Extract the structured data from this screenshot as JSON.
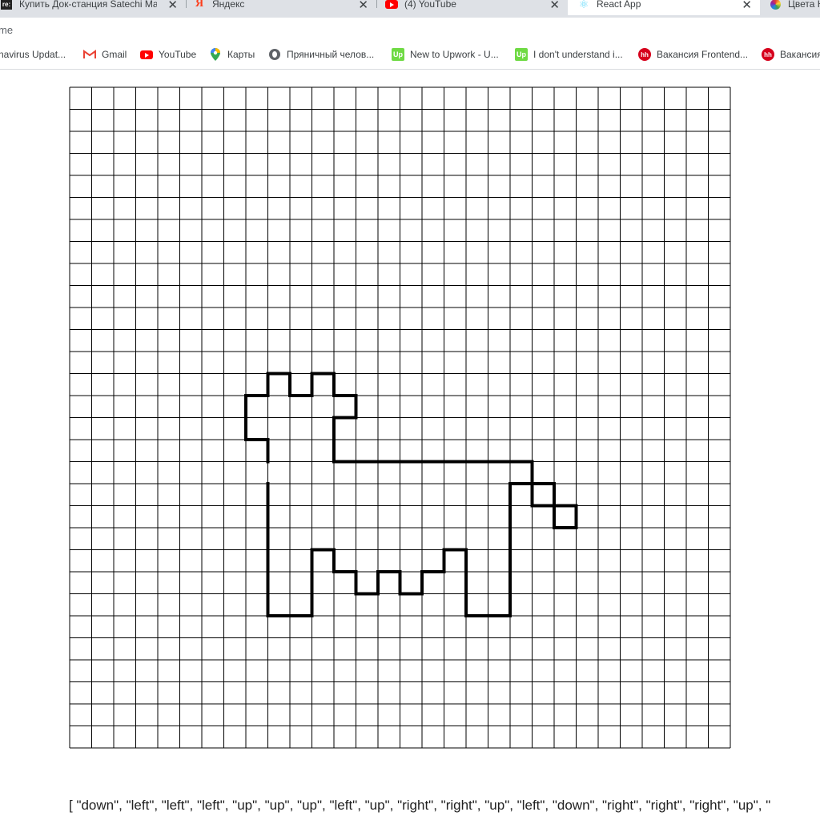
{
  "browser": {
    "tabs": [
      {
        "title": "Купить Док-станция Satechi Mac",
        "favicon": "shop-favicon",
        "active": false
      },
      {
        "title": "Яндекс",
        "favicon": "yandex-icon",
        "active": false
      },
      {
        "title": "(4) YouTube",
        "favicon": "youtube-icon",
        "active": false
      },
      {
        "title": "React App",
        "favicon": "react-icon",
        "active": true
      },
      {
        "title": "Цвета H",
        "favicon": "color-wheel-icon",
        "active": false
      }
    ],
    "close_glyph": "✕",
    "address": "me",
    "bookmarks": [
      {
        "label": "navirus Updat...",
        "icon": "none"
      },
      {
        "label": "Gmail",
        "icon": "gmail-icon"
      },
      {
        "label": "YouTube",
        "icon": "youtube-icon"
      },
      {
        "label": "Карты",
        "icon": "maps-icon"
      },
      {
        "label": "Пряничный челов...",
        "icon": "globe-icon"
      },
      {
        "label": "New to Upwork - U...",
        "icon": "upwork-icon"
      },
      {
        "label": "I don't understand i...",
        "icon": "upwork-icon"
      },
      {
        "label": "Вакансия Frontend...",
        "icon": "hh-icon"
      },
      {
        "label": "Вакансия",
        "icon": "hh-icon"
      }
    ]
  },
  "drawing": {
    "grid_size": 30,
    "grid_color": "#000000",
    "path_color": "#000000",
    "start_cell": [
      9,
      17
    ],
    "moves": [
      "up",
      "left",
      "up",
      "up",
      "right",
      "up",
      "right",
      "down",
      "right",
      "up",
      "right",
      "down",
      "right",
      "down",
      "left",
      "down",
      "down",
      "right",
      "right",
      "right",
      "right",
      "right",
      "right",
      "right",
      "right",
      "right",
      "down",
      "right",
      "down",
      "right",
      "down",
      "left",
      "up",
      "left",
      "up",
      "left",
      "down",
      "down",
      "down",
      "down",
      "down",
      "down",
      "left",
      "left",
      "up",
      "up",
      "up",
      "left",
      "down",
      "left",
      "down",
      "left",
      "up",
      "left",
      "down",
      "left",
      "up",
      "left",
      "up",
      "left",
      "down",
      "down",
      "down",
      "left",
      "left",
      "up",
      "up",
      "up",
      "up",
      "up",
      "up"
    ]
  },
  "output": {
    "text": "[ \"down\", \"left\", \"left\", \"left\", \"up\", \"up\", \"up\", \"left\", \"up\", \"right\", \"right\", \"up\", \"left\", \"down\", \"right\", \"right\", \"right\", \"up\", \""
  }
}
